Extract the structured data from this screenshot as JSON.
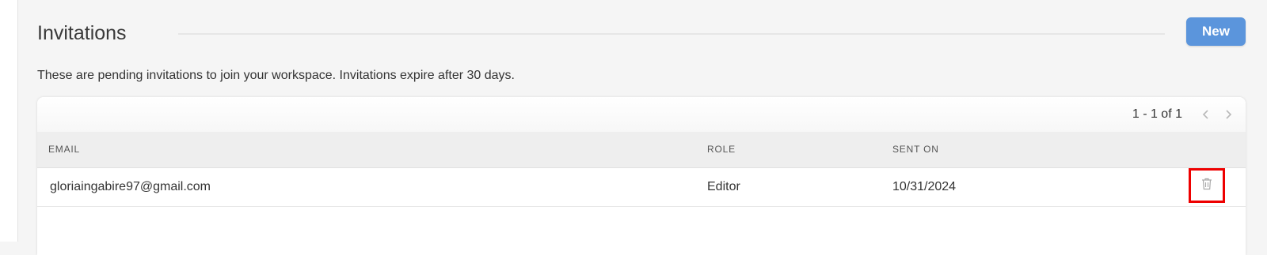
{
  "invitations": {
    "title": "Invitations",
    "new_label": "New",
    "description": "These are pending invitations to join your workspace. Invitations expire after 30 days.",
    "pagination": {
      "range_text": "1 - 1 of 1",
      "prev_icon": "chevron-left-icon",
      "next_icon": "chevron-right-icon"
    },
    "columns": {
      "email": "EMAIL",
      "role": "ROLE",
      "sent_on": "SENT ON"
    },
    "rows": [
      {
        "email": "gloriaingabire97@gmail.com",
        "role": "Editor",
        "sent_on": "10/31/2024",
        "action_icon": "trash-icon"
      }
    ]
  },
  "colors": {
    "accent": "#5b95dc",
    "highlight": "#ee0000",
    "background": "#f5f5f5"
  }
}
